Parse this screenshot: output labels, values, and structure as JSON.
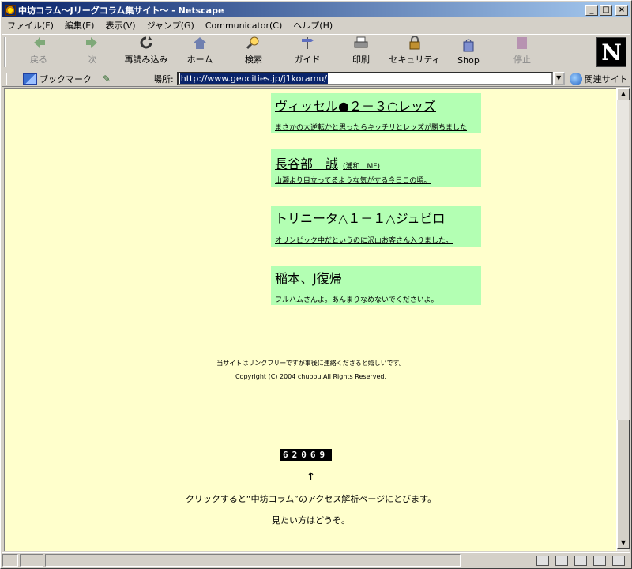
{
  "window": {
    "title": "中坊コラム～Jリーグコラム集サイト～ - Netscape",
    "minimize_label": "_",
    "maximize_label": "□",
    "close_label": "×"
  },
  "menu": [
    "ファイル(F)",
    "編集(E)",
    "表示(V)",
    "ジャンプ(G)",
    "Communicator(C)",
    "ヘルプ(H)"
  ],
  "toolbar": {
    "back": "戻る",
    "forward": "次",
    "reload": "再読み込み",
    "home": "ホーム",
    "search": "検索",
    "guide": "ガイド",
    "print": "印刷",
    "security": "セキュリティ",
    "shop": "Shop",
    "stop": "停止",
    "logo": "N"
  },
  "location": {
    "bookmarks": "ブックマーク",
    "label": "場所:",
    "url": "http://www.geocities.jp/j1koramu/",
    "related": "関連サイト"
  },
  "articles": [
    {
      "title": "ヴィッセル●２－３○レッズ",
      "note": "",
      "desc": "まさかの大逆転かと思ったらキッチリとレッズが勝ちました"
    },
    {
      "title": "長谷部　誠",
      "note": "(浦和　MF)",
      "desc": "山瀬より目立ってるような気がする今日この頃。"
    },
    {
      "title": "トリニータ△１－１△ジュビロ",
      "note": "",
      "desc": "オリンピック中だというのに沢山お客さん入りました。"
    },
    {
      "title": "稲本、J復帰",
      "note": "",
      "desc": "フルハムさんよ。あんまりなめないでくださいよ。"
    }
  ],
  "footer": {
    "link_free": "当サイトはリンクフリーですが事後に連絡くださると嬉しいです。",
    "copyright": "Copyright (C) 2004 chubou.All Rights Reserved."
  },
  "counter": "62069",
  "arrow": "↑",
  "access_note": "クリックすると“中坊コラム”のアクセス解析ページにとびます。",
  "access_note2": "見たい方はどうぞ。",
  "colors": {
    "page_bg": "#ffffcc",
    "box_bg": "#b3ffb3",
    "titlebar": "#0a246a"
  }
}
